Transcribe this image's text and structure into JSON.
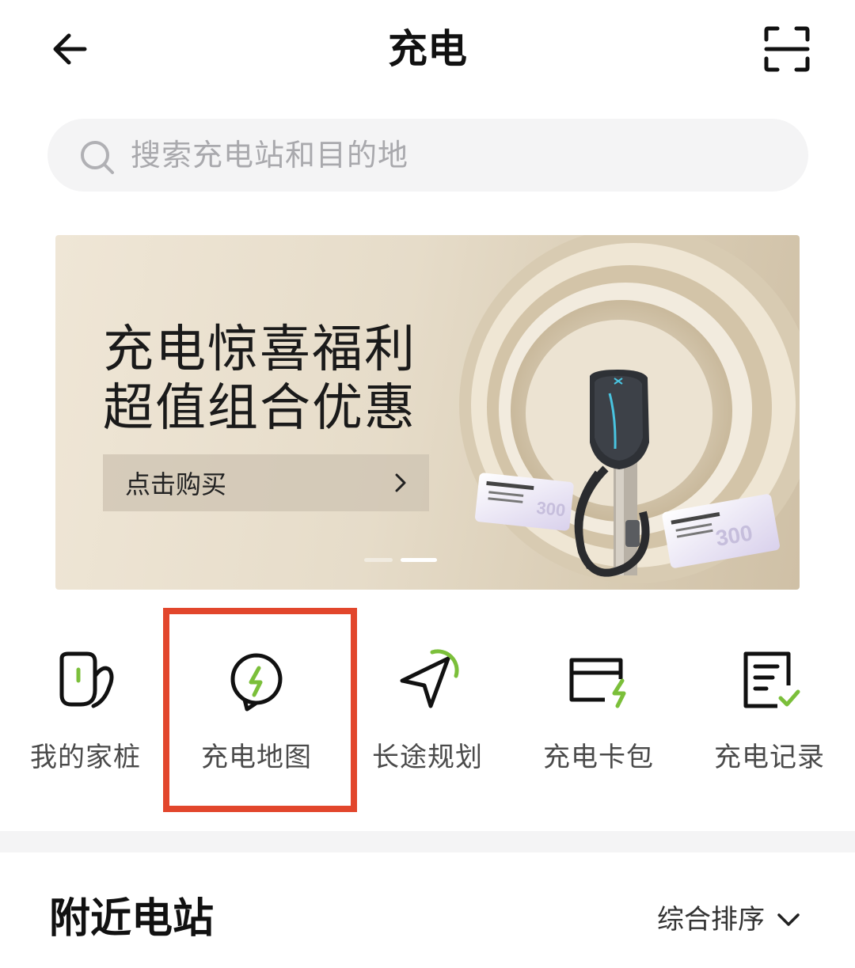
{
  "header": {
    "title": "充电",
    "back_icon": "back-arrow-icon",
    "scan_icon": "scan-icon"
  },
  "search": {
    "placeholder": "搜索充电站和目的地"
  },
  "banner": {
    "title_line1": "充电惊喜福利",
    "title_line2": "超值组合优惠",
    "cta_label": "点击购买",
    "card_value_1": "300",
    "card_value_2": "300",
    "slides": 2,
    "active_slide": 2
  },
  "actions": [
    {
      "label": "我的家桩",
      "icon": "home-charger-icon"
    },
    {
      "label": "充电地图",
      "icon": "charging-map-pin-icon"
    },
    {
      "label": "长途规划",
      "icon": "navigation-arrow-icon"
    },
    {
      "label": "充电卡包",
      "icon": "charging-card-icon"
    },
    {
      "label": "充电记录",
      "icon": "charging-record-icon"
    }
  ],
  "nearby": {
    "title": "附近电站",
    "sort_label": "综合排序"
  },
  "colors": {
    "accent_green": "#7bbf3a",
    "highlight_red": "#e2462c",
    "search_bg": "#f4f4f5"
  }
}
